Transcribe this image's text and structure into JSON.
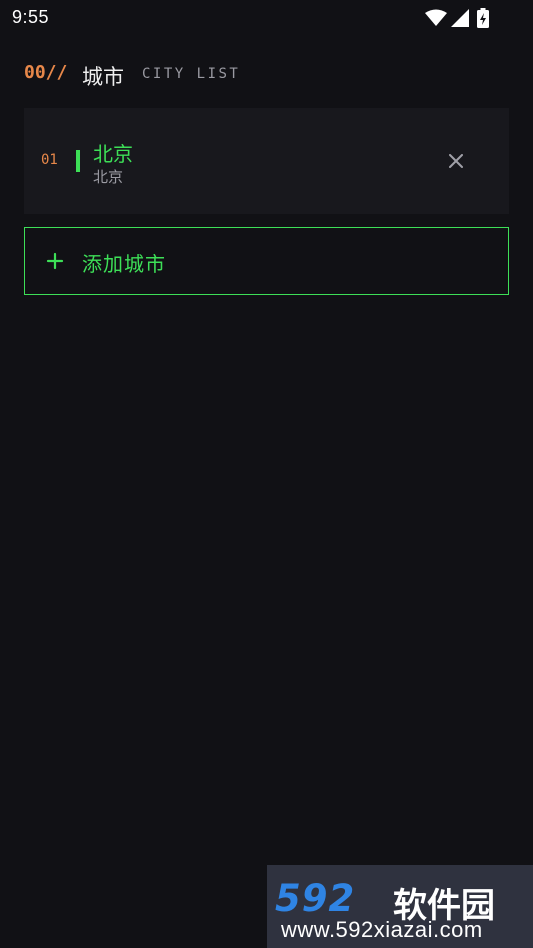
{
  "status_bar": {
    "time": "9:55",
    "icons": [
      "wifi-icon",
      "signal-icon",
      "battery-charging-icon"
    ]
  },
  "header": {
    "number": "00//",
    "title": "城市",
    "subtitle": "CITY LIST"
  },
  "cities": [
    {
      "index": "01",
      "name": "北京",
      "subtitle": "北京"
    }
  ],
  "add_button": {
    "label": "添加城市"
  },
  "watermark": {
    "logo_number": "592",
    "logo_text": "软件园",
    "url": "www.592xiazai.com"
  },
  "colors": {
    "background": "#111115",
    "card": "#18181d",
    "accent_green": "#3ddf57",
    "accent_orange": "#e8884a"
  }
}
